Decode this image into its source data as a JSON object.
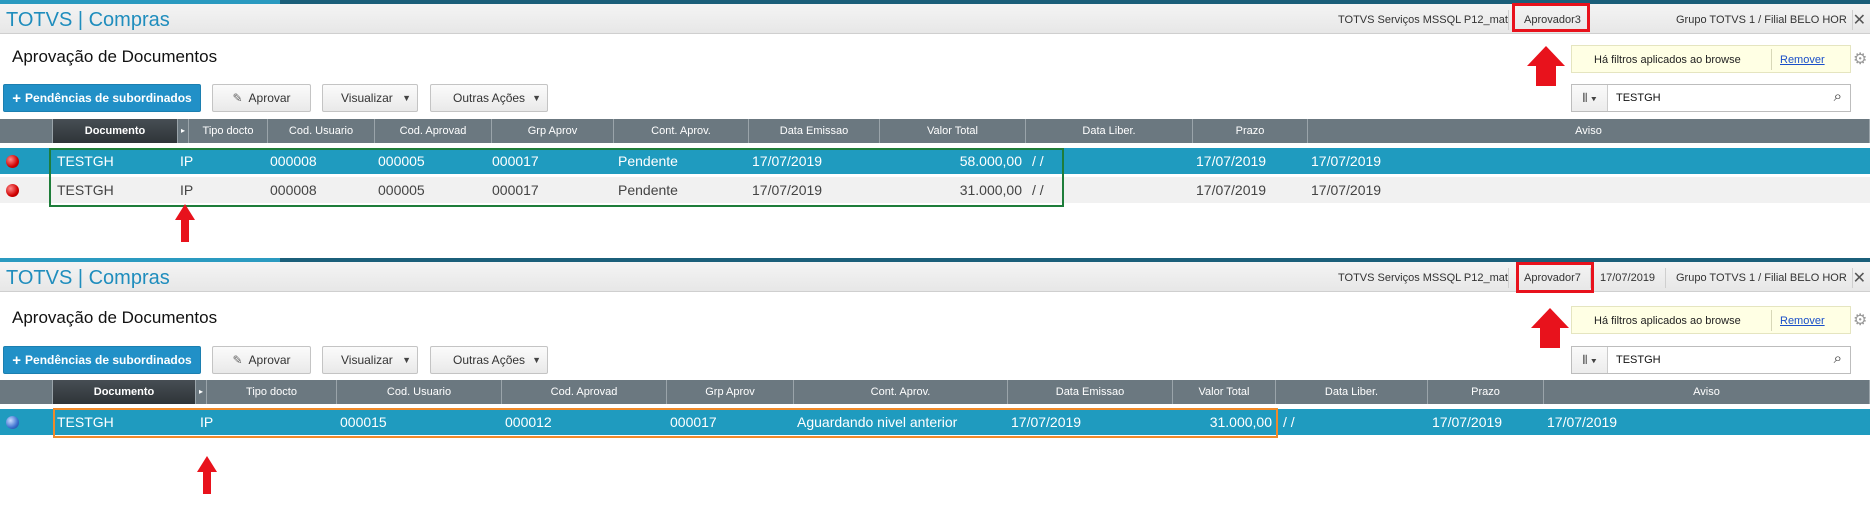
{
  "panels": [
    {
      "app_title": "TOTVS | Compras",
      "env": "TOTVS Serviços MSSQL P12_mat",
      "user": "Aprovador3",
      "date": "",
      "branch": "Grupo TOTVS 1 / Filial BELO HOR",
      "close": "✕",
      "page_title": "Aprovação de Documentos",
      "buttons": {
        "pend": "Pendências de subordinados",
        "aprovar": "Aprovar",
        "visualizar": "Visualizar",
        "outras": "Outras Ações"
      },
      "filter_msg": "Há filtros aplicados ao browse",
      "filter_remove": "Remover",
      "search_value": "TESTGH",
      "columns": [
        "Documento",
        "▸",
        "Tipo docto",
        "Cod. Usuario",
        "Cod. Aprovad",
        "Grp Aprov",
        "Cont. Aprov.",
        "Data Emissao",
        "Valor Total",
        "Data Liber.",
        "Prazo",
        "Aviso"
      ],
      "rows": [
        {
          "status": "red",
          "cells": [
            "TESTGH",
            "IP",
            "000008",
            "000005",
            "000017",
            "Pendente",
            "17/07/2019",
            "58.000,00",
            " /  /",
            "17/07/2019",
            "17/07/2019"
          ]
        },
        {
          "status": "red",
          "cells": [
            "TESTGH",
            "IP",
            "000008",
            "000005",
            "000017",
            "Pendente",
            "17/07/2019",
            "31.000,00",
            " /  /",
            "17/07/2019",
            "17/07/2019"
          ]
        }
      ]
    },
    {
      "app_title": "TOTVS | Compras",
      "env": "TOTVS Serviços MSSQL P12_mat",
      "user": "Aprovador7",
      "date": "17/07/2019",
      "branch": "Grupo TOTVS 1 / Filial BELO HOR",
      "close": "✕",
      "page_title": "Aprovação de Documentos",
      "buttons": {
        "pend": "Pendências de subordinados",
        "aprovar": "Aprovar",
        "visualizar": "Visualizar",
        "outras": "Outras Ações"
      },
      "filter_msg": "Há filtros aplicados ao browse",
      "filter_remove": "Remover",
      "search_value": "TESTGH",
      "columns": [
        "Documento",
        "▸",
        "Tipo docto",
        "Cod. Usuario",
        "Cod. Aprovad",
        "Grp Aprov",
        "Cont. Aprov.",
        "Data Emissao",
        "Valor Total",
        "Data Liber.",
        "Prazo",
        "Aviso"
      ],
      "rows": [
        {
          "status": "blue",
          "cells": [
            "TESTGH",
            "IP",
            "000015",
            "000012",
            "000017",
            "Aguardando nivel anterior",
            "17/07/2019",
            "31.000,00",
            " /  /",
            "17/07/2019",
            "17/07/2019"
          ]
        }
      ]
    }
  ],
  "colors": {
    "accent": "#1f8dbd",
    "selected_row": "#1f9bbf",
    "header": "#6b7880",
    "annotation_red": "#e8121c",
    "annotation_green": "#1e7d3a",
    "annotation_orange": "#f08a2a"
  }
}
